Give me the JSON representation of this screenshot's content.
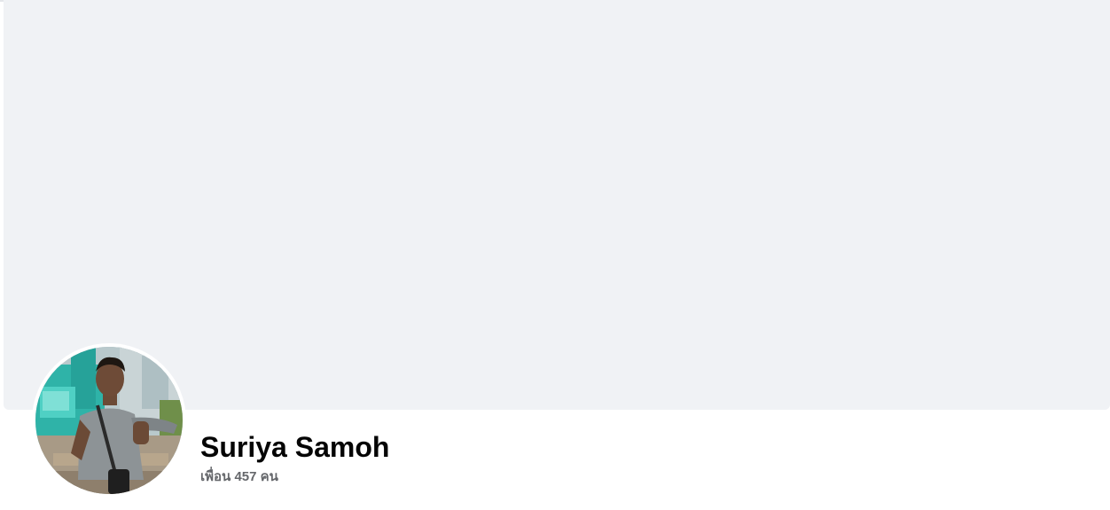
{
  "profile": {
    "name": "Suriya Samoh",
    "friends_label": "เพื่อน 457 คน"
  },
  "colors": {
    "cover_background": "#f0f2f5",
    "name_text": "#050505",
    "secondary_text": "#65676b"
  }
}
